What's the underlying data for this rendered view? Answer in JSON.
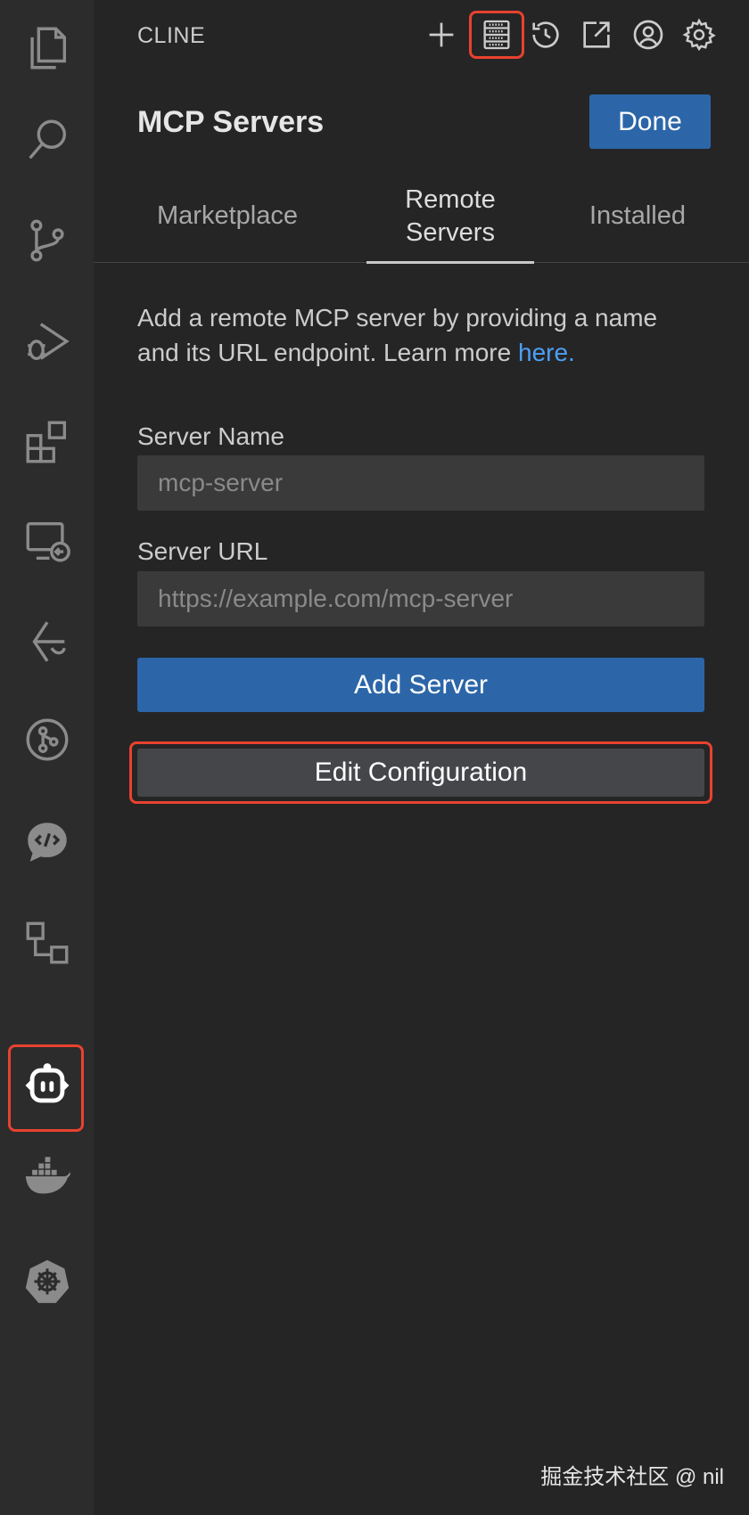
{
  "activity_bar": {
    "items": [
      {
        "name": "explorer-icon"
      },
      {
        "name": "search-icon"
      },
      {
        "name": "source-control-icon"
      },
      {
        "name": "run-debug-icon"
      },
      {
        "name": "extensions-icon"
      },
      {
        "name": "remote-explorer-icon"
      },
      {
        "name": "git-lens-icon"
      },
      {
        "name": "git-graph-icon"
      },
      {
        "name": "code-chat-icon"
      },
      {
        "name": "flow-icon"
      },
      {
        "name": "cline-robot-icon",
        "highlighted": true
      },
      {
        "name": "docker-icon"
      },
      {
        "name": "kubernetes-icon"
      }
    ]
  },
  "topbar": {
    "title": "CLINE",
    "icons": [
      "plus-icon",
      "mcp-servers-icon",
      "history-icon",
      "popout-icon",
      "account-icon",
      "gear-icon"
    ]
  },
  "header": {
    "title": "MCP Servers",
    "done_label": "Done"
  },
  "tabs": [
    {
      "label": "Marketplace",
      "active": false
    },
    {
      "label": "Remote Servers",
      "active": true
    },
    {
      "label": "Installed",
      "active": false
    }
  ],
  "form": {
    "description": "Add a remote MCP server by providing a name and its URL endpoint. Learn more ",
    "link_text": "here.",
    "server_name_label": "Server Name",
    "server_name_placeholder": "mcp-server",
    "server_url_label": "Server URL",
    "server_url_placeholder": "https://example.com/mcp-server",
    "add_button": "Add Server",
    "edit_button": "Edit Configuration"
  },
  "watermark": "掘金技术社区 @ nil",
  "colors": {
    "accent": "#2c66a8",
    "highlight": "#e8422f",
    "link": "#4d9ff5"
  }
}
